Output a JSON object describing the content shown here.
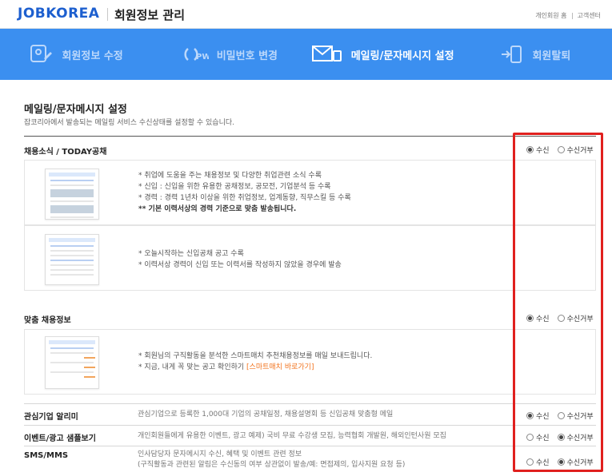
{
  "header": {
    "logo": "JOBKOREA",
    "title": "회원정보 관리",
    "links": [
      "개인회원 홈",
      "고객센터"
    ]
  },
  "tabs": [
    {
      "label": "회원정보 수정",
      "icon": "profile-edit-icon",
      "active": false
    },
    {
      "label": "비밀번호 변경",
      "icon": "password-refresh-icon",
      "active": false
    },
    {
      "label": "메일링/문자메시지 설정",
      "icon": "mail-message-icon",
      "active": true
    },
    {
      "label": "회원탈퇴",
      "icon": "withdraw-icon",
      "active": false
    }
  ],
  "section": {
    "title": "메일링/문자메시지 설정",
    "description": "잡코리아에서 발송되는 메일링 서비스 수신상태를 설정할 수 있습니다."
  },
  "radio_labels": {
    "receive": "수신",
    "reject": "수신거부"
  },
  "groups": {
    "today": {
      "label": "채용소식 / TODAY공채",
      "selected": "receive",
      "card1": {
        "bullets": [
          "* 취업에 도움을 주는 채용정보 및 다양한 취업관련 소식 수록",
          "* 신입 : 신입을 위한 유용한 공채정보, 공모전, 기업분석 등 수록",
          "* 경력 : 경력 1년차 이상을 위한 취업정보, 업계동향, 직무스킬 등 수록"
        ],
        "note": "** 기본 이력서상의 경력 기준으로 맞춤 발송됩니다."
      },
      "card2": {
        "bullets": [
          "* 오늘시작하는 신입공채 공고 수록",
          "* 이력서상 경력이 신입 또는 이력서를 작성하지 않았을 경우에 발송"
        ]
      }
    },
    "custom": {
      "label": "맞춤 채용정보",
      "selected": "receive",
      "card": {
        "line1": "* 회원님의 구직활동을 분석한 스마트매치 추천채용정보를 매일 보내드립니다.",
        "line2_prefix": "* 지금, 내게 꼭 맞는 공고 확인하기",
        "line2_link": "[스마트매치 바로가기]"
      }
    }
  },
  "rows": [
    {
      "label": "관심기업 알리미",
      "description": "관심기업으로 등록한 1,000대 기업의 공채일정, 채용설명회 등 신입공채 맞춤형 메일",
      "selected": "receive"
    },
    {
      "label": "이벤트/광고 샘플보기",
      "description": "개인회원들에게 유용한 이벤트, 광고 예제) 국비 무료 수강생 모집, 능력협회 개발원, 해외인턴사원 모집",
      "selected": "reject"
    },
    {
      "label": "SMS/MMS",
      "description": "인사담당자 문자메시지 수신, 혜택 및 이벤트 관련 정보",
      "description2": "(구직활동과 관련된 알림은 수신동의 여부 상관없이 발송/예: 면접제의, 입사지원 요청 등)",
      "selected": "reject"
    }
  ],
  "colors": {
    "tab_band": "#3b8ff0",
    "logo": "#1d5fcf",
    "highlight": "#e0201e",
    "link": "#f2731d"
  }
}
